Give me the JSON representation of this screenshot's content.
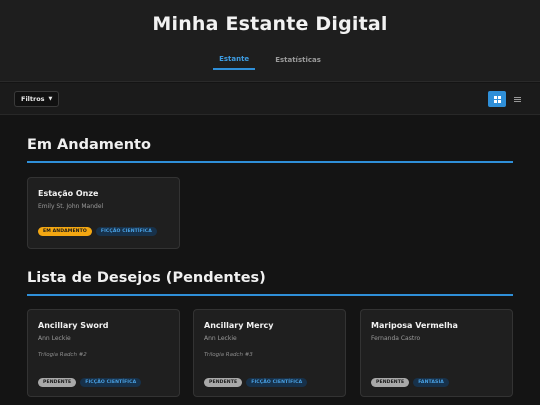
{
  "app": {
    "title": "Minha Estante Digital"
  },
  "tabs": [
    {
      "label": "Estante",
      "active": true
    },
    {
      "label": "Estatísticas",
      "active": false
    }
  ],
  "toolbar": {
    "filter_label": "Filtros",
    "view_mode": "grid"
  },
  "sections": [
    {
      "title": "Em Andamento",
      "cards": [
        {
          "title": "Estação Onze",
          "author": "Emily St. John Mandel",
          "series": "",
          "status": "EM ANDAMENTO",
          "genre": "FICÇÃO CIENTÍFICA"
        }
      ]
    },
    {
      "title": "Lista de Desejos (Pendentes)",
      "cards": [
        {
          "title": "Ancillary Sword",
          "author": "Ann Leckie",
          "series": "Trilogia Radch #2",
          "status": "PENDENTE",
          "genre": "FICÇÃO CIENTÍFICA"
        },
        {
          "title": "Ancillary Mercy",
          "author": "Ann Leckie",
          "series": "Trilogia Radch #3",
          "status": "PENDENTE",
          "genre": "FICÇÃO CIENTÍFICA"
        },
        {
          "title": "Mariposa Vermelha",
          "author": "Fernanda Castro",
          "series": "",
          "status": "PENDENTE",
          "genre": "FANTASIA"
        }
      ]
    }
  ],
  "colors": {
    "accent": "#2f8fd8",
    "status_reading": "#f3a712",
    "status_pending": "#a9a9a9",
    "genre_badge_bg": "#17314a",
    "genre_badge_text": "#4aa3e6"
  }
}
